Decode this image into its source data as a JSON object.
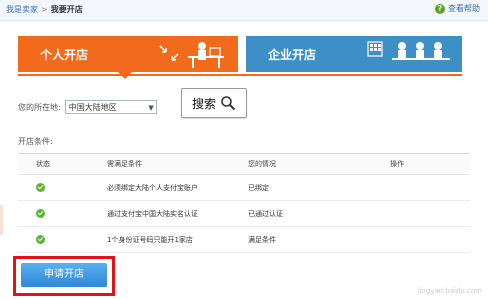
{
  "breadcrumb": {
    "home": "我是卖家",
    "separator": ">",
    "current": "我要开店"
  },
  "help": {
    "label": "查看帮助"
  },
  "tabs": [
    {
      "label": "个人开店",
      "active": true,
      "color": "#f26a1b"
    },
    {
      "label": "企业开店",
      "active": false,
      "color": "#3d8fc8"
    }
  ],
  "location": {
    "label": "您的所在地:",
    "value": "中国大陆地区"
  },
  "search": {
    "label": "搜索",
    "icon": "magnifier-icon"
  },
  "conditions": {
    "title": "开店条件:",
    "headers": [
      "状态",
      "需满足条件",
      "您的情况",
      "操作"
    ],
    "rows": [
      {
        "requirement": "必须绑定大陆个人支付宝账户",
        "yours": "已绑定",
        "action": ""
      },
      {
        "requirement": "通过支付宝中国大陆实名认证",
        "yours": "已通过认证",
        "action": ""
      },
      {
        "requirement": "1个身份证号码只能开1家店",
        "yours": "满足条件",
        "action": ""
      }
    ]
  },
  "apply": {
    "label": "申请开店"
  },
  "watermark": "jingyan.baidu.com"
}
